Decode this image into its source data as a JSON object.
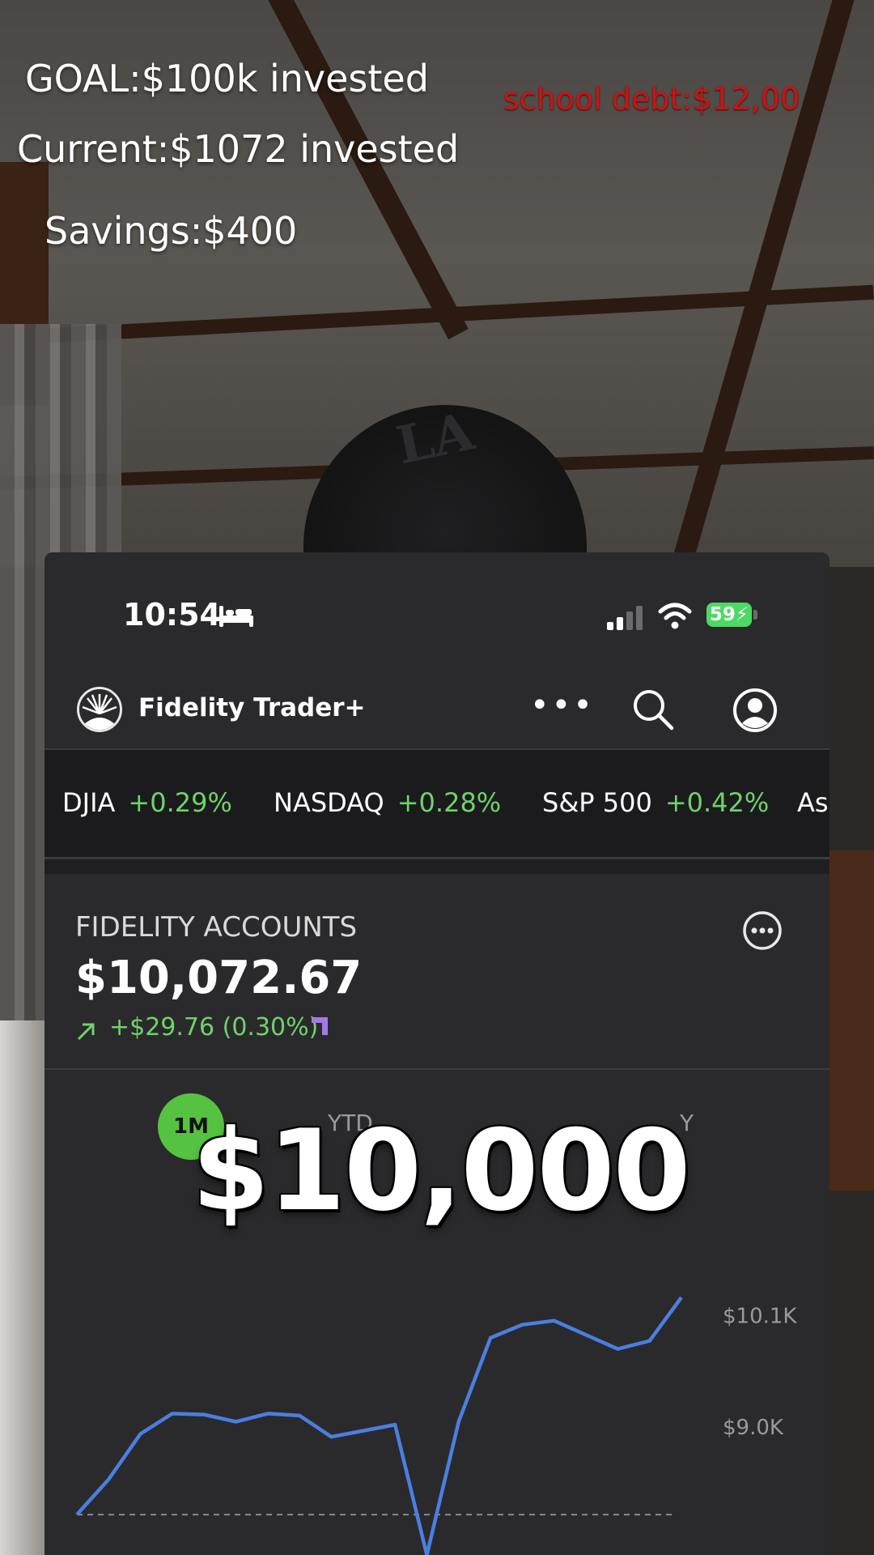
{
  "overlay": {
    "goal": "GOAL:$100k invested",
    "current": "Current:$1072 invested",
    "savings": "Savings:$400",
    "debt": "school debt:$12,00",
    "amount": "$10,000"
  },
  "status_bar": {
    "time": "10:54",
    "battery": "59",
    "icons": [
      "bed-icon",
      "signal-icon",
      "wifi-icon",
      "battery-icon"
    ]
  },
  "app": {
    "title": "Fidelity Trader+",
    "icons": [
      "fidelity-logo-icon",
      "more-icon",
      "search-icon",
      "account-icon"
    ]
  },
  "ticker": [
    {
      "name": "DJIA",
      "change": "+0.29%"
    },
    {
      "name": "NASDAQ",
      "change": "+0.28%"
    },
    {
      "name": "S&P 500",
      "change": "+0.42%"
    },
    {
      "name": "As",
      "change": ""
    }
  ],
  "account": {
    "label": "FIDELITY ACCOUNTS",
    "value": "$10,072.67",
    "change": "+$29.76 (0.30%)"
  },
  "ranges": {
    "selected": "1M",
    "others": [
      "YTD",
      "Y"
    ]
  },
  "colors": {
    "positive": "#6fd26a",
    "range_pill": "#56c241",
    "line": "#4a7fe0",
    "debt_text": "#d40f0f"
  },
  "chart_data": {
    "type": "line",
    "y_ticks": [
      "$10.1K",
      "$9.0K"
    ],
    "series": [
      {
        "values": [
          8.2,
          8.55,
          9.0,
          9.2,
          9.19,
          9.12,
          9.2,
          9.18,
          8.97,
          9.03,
          9.09,
          7.8,
          9.12,
          9.95,
          10.08,
          10.12,
          9.98,
          9.84,
          9.92,
          10.35
        ]
      }
    ],
    "ylim": [
      7.8,
      10.35
    ],
    "baseline": 8.2
  }
}
